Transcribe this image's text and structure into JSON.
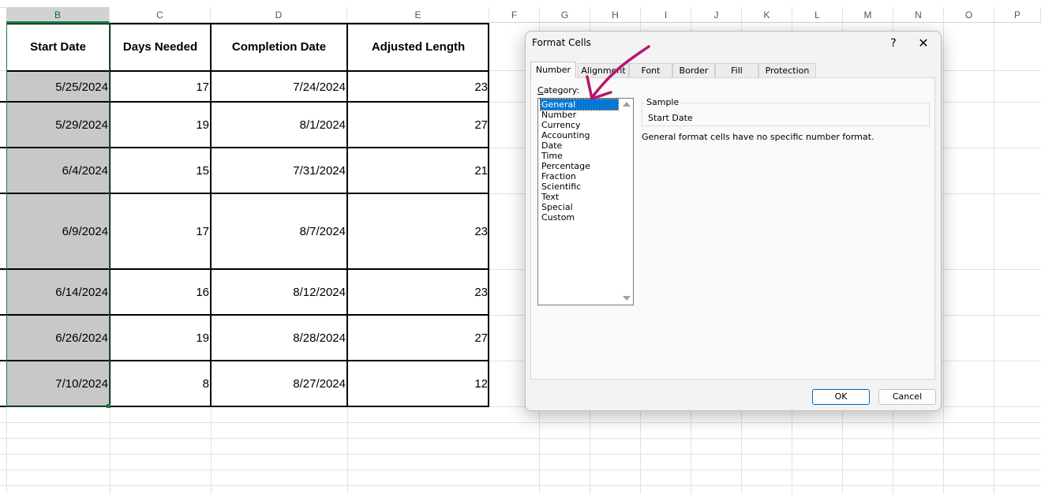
{
  "sheet": {
    "columns": [
      "B",
      "C",
      "D",
      "E",
      "F",
      "G",
      "H",
      "I",
      "J",
      "K",
      "L",
      "M",
      "N",
      "O",
      "P"
    ],
    "headers": {
      "start_date": "Start Date",
      "days_needed": "Days Needed",
      "completion_date": "Completion Date",
      "adjusted_length": "Adjusted Length"
    },
    "rows": [
      {
        "start": "5/25/2024",
        "days": "17",
        "completion": "7/24/2024",
        "adjusted": "23"
      },
      {
        "start": "5/29/2024",
        "days": "19",
        "completion": "8/1/2024",
        "adjusted": "27"
      },
      {
        "start": "6/4/2024",
        "days": "15",
        "completion": "7/31/2024",
        "adjusted": "21"
      },
      {
        "start": "6/9/2024",
        "days": "17",
        "completion": "8/7/2024",
        "adjusted": "23"
      },
      {
        "start": "6/14/2024",
        "days": "16",
        "completion": "8/12/2024",
        "adjusted": "23"
      },
      {
        "start": "6/26/2024",
        "days": "19",
        "completion": "8/28/2024",
        "adjusted": "27"
      },
      {
        "start": "7/10/2024",
        "days": "8",
        "completion": "8/27/2024",
        "adjusted": "12"
      }
    ],
    "selected_column": "B",
    "accent_color": "#107c41"
  },
  "dialog": {
    "title": "Format Cells",
    "help_glyph": "?",
    "close_glyph": "✕",
    "tabs": [
      "Number",
      "Alignment",
      "Font",
      "Border",
      "Fill",
      "Protection"
    ],
    "active_tab": "Number",
    "category_label_underlined": "C",
    "category_label_rest": "ategory:",
    "categories": [
      "General",
      "Number",
      "Currency",
      "Accounting",
      "Date",
      "Time",
      "Percentage",
      "Fraction",
      "Scientific",
      "Text",
      "Special",
      "Custom"
    ],
    "selected_category": "General",
    "sample_label": "Sample",
    "sample_value": "Start Date",
    "description": "General format cells have no specific number format.",
    "ok_label": "OK",
    "cancel_label": "Cancel",
    "selection_color": "#0078d7"
  },
  "annotation": {
    "arrow_icon": "arrow-annotation-icon",
    "arrow_color": "#b5176f"
  }
}
